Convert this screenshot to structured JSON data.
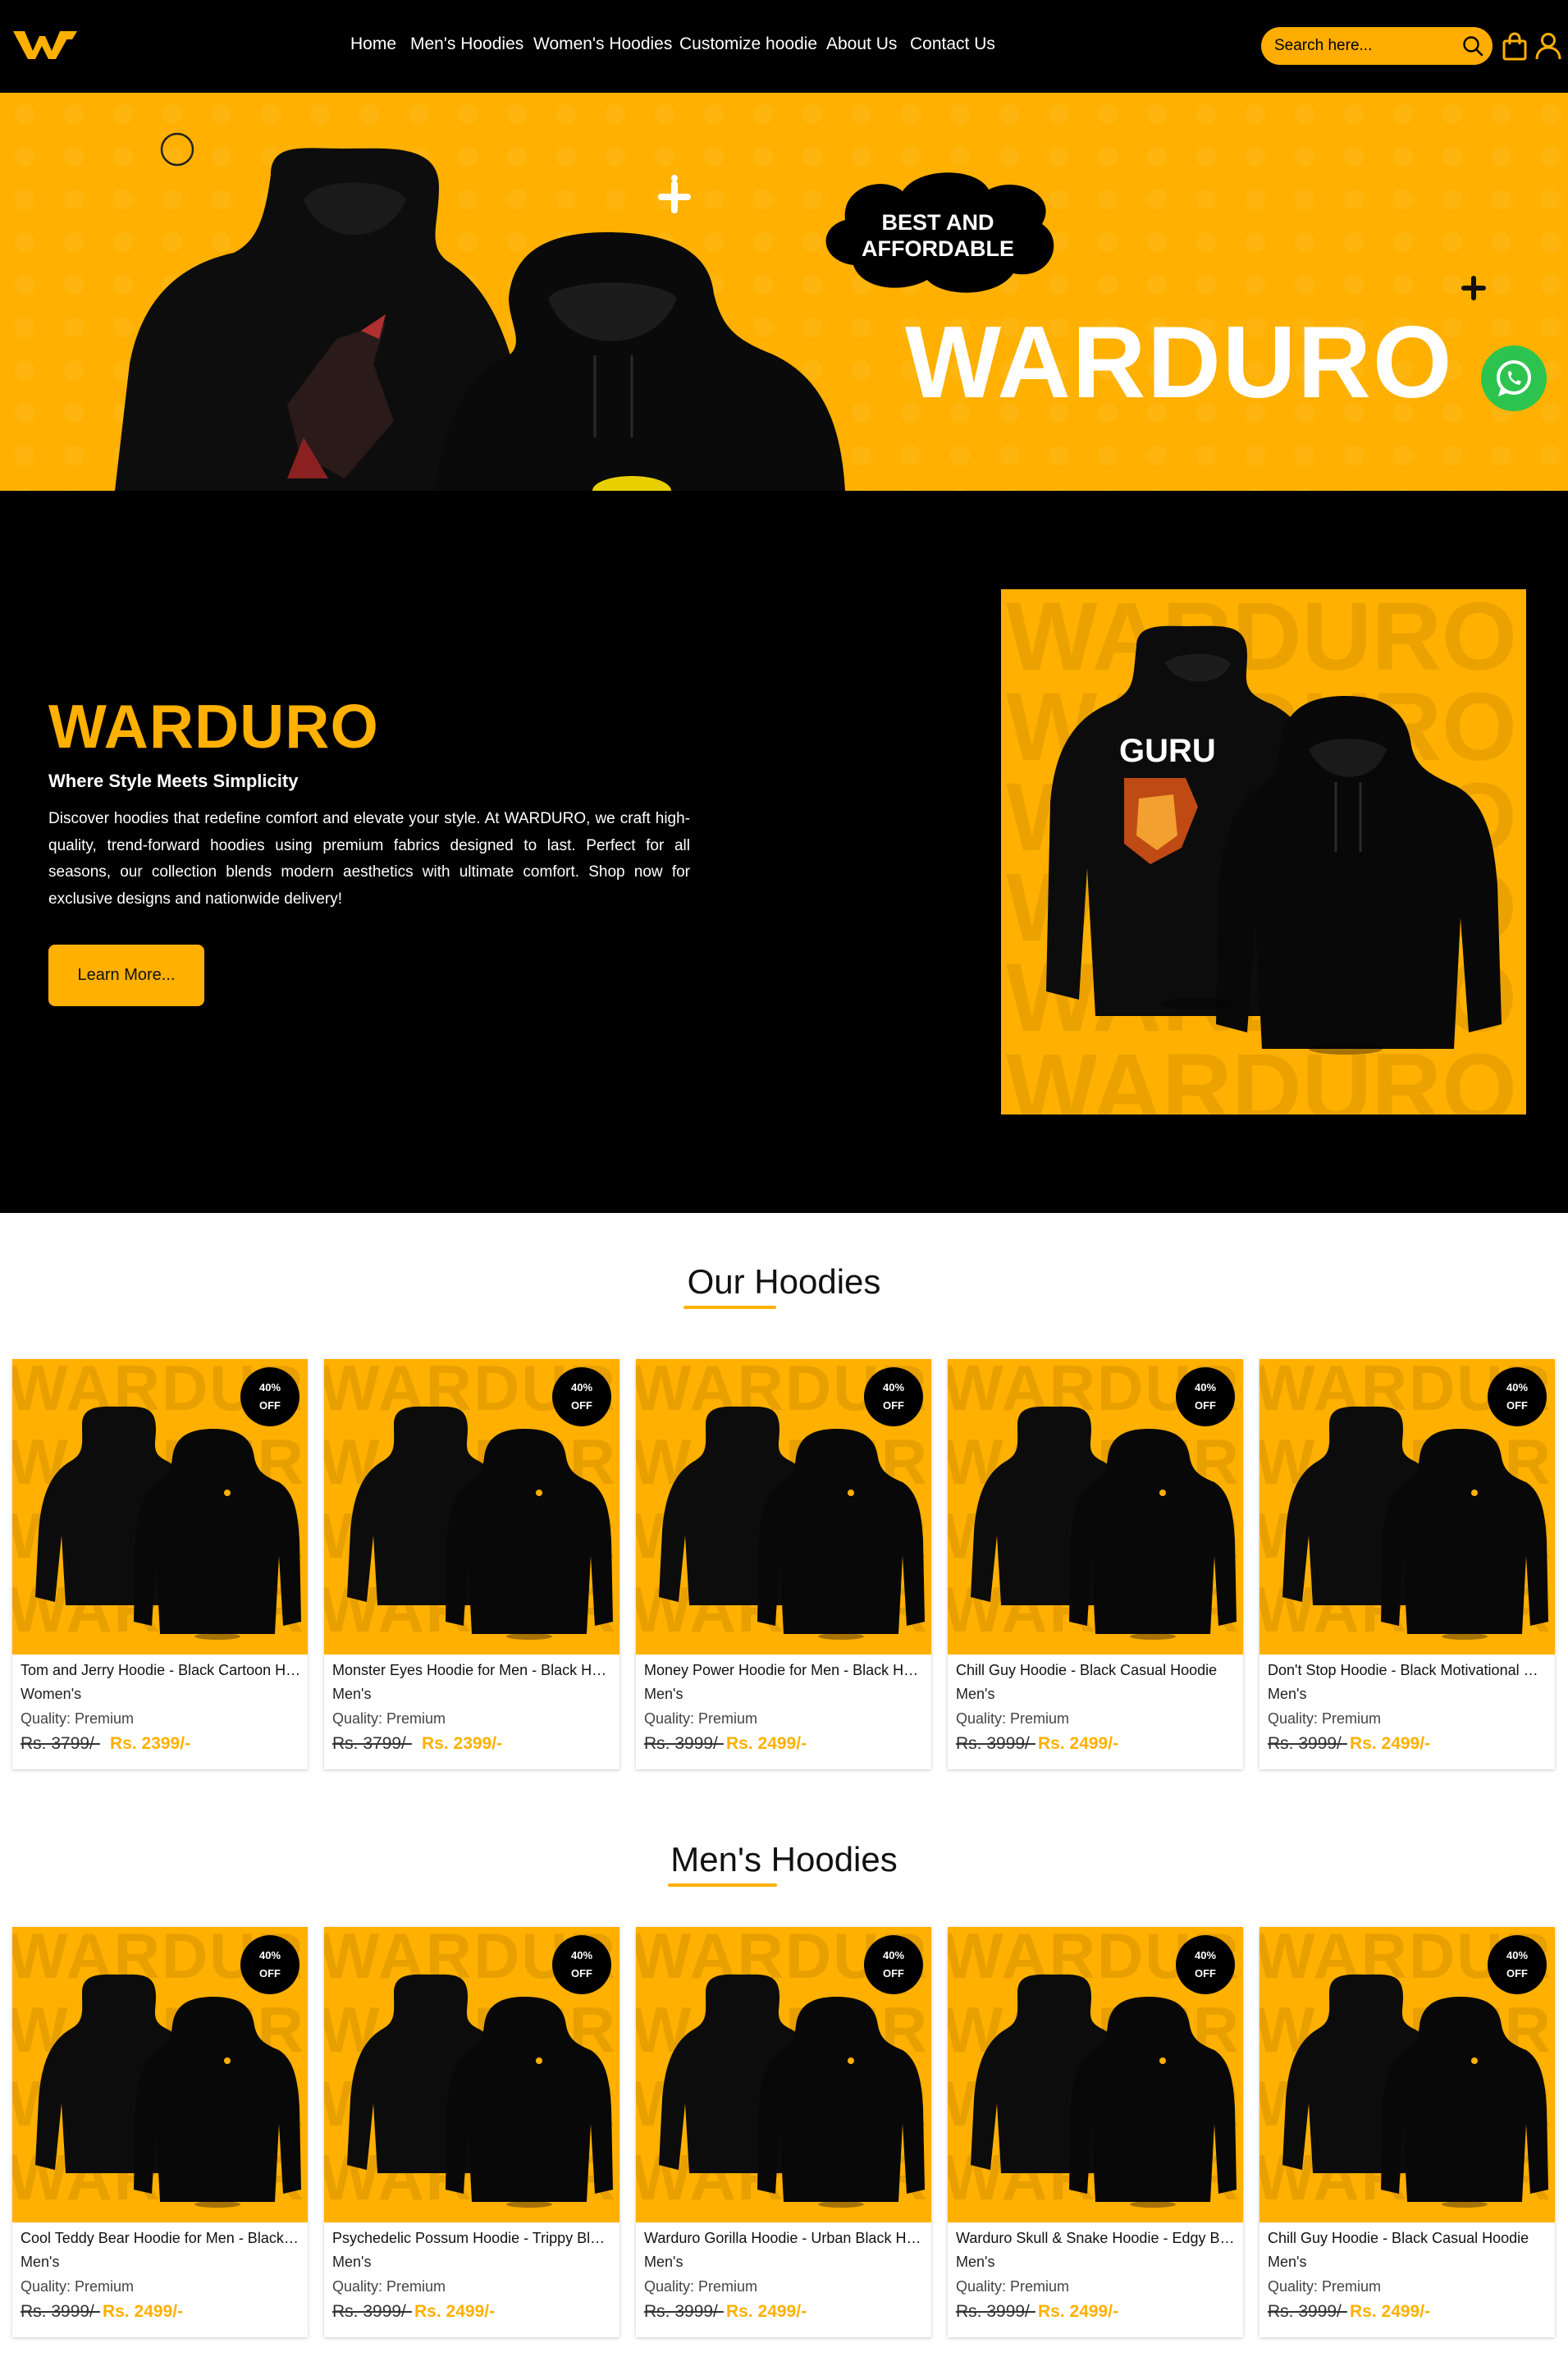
{
  "nav": {
    "brand_logo": "warduro-w-logo",
    "items": [
      "Home",
      "Men's Hoodies",
      "Women's Hoodies",
      "Customize hoodie",
      "About Us",
      "Contact Us"
    ],
    "search_placeholder": "Search here...",
    "icons": [
      "search-icon",
      "shopping-bag-icon",
      "user-icon"
    ]
  },
  "hero": {
    "title": "WARDURO",
    "cloud_line1": "BEST AND",
    "cloud_line2": "AFFORDABLE"
  },
  "about": {
    "title": "WARDURO",
    "subtitle": "Where Style Meets Simplicity",
    "text": "Discover hoodies that redefine comfort and elevate your style. At WARDURO, we craft high-quality, trend-forward hoodies using premium fabrics designed to last. Perfect for all seasons, our collection blends modern aesthetics with ultimate comfort. Shop now for exclusive designs and nationwide delivery!",
    "button": "Learn More...",
    "image_print": "GURU",
    "image_watermark": "WARDURO"
  },
  "sections": [
    {
      "title": "Our Hoodies",
      "products": [
        {
          "name": "Tom and Jerry Hoodie - Black Cartoon Hoodie",
          "category": "Women's",
          "quality": "Quality: Premium",
          "old_price": "Rs. 3799/-",
          "new_price": "Rs. 2399/-",
          "badge_line1": "40%",
          "badge_line2": "OFF"
        },
        {
          "name": "Monster Eyes Hoodie for Men - Black Hoodie",
          "category": "Men's",
          "quality": "Quality: Premium",
          "old_price": "Rs. 3799/-",
          "new_price": "Rs. 2399/-",
          "badge_line1": "40%",
          "badge_line2": "OFF"
        },
        {
          "name": "Money Power Hoodie for Men - Black Hoodie",
          "category": "Men's",
          "quality": "Quality: Premium",
          "old_price": "Rs. 3999/-",
          "new_price": "Rs. 2499/-",
          "badge_line1": "40%",
          "badge_line2": "OFF"
        },
        {
          "name": "Chill Guy Hoodie - Black Casual Hoodie",
          "category": "Men's",
          "quality": "Quality: Premium",
          "old_price": "Rs. 3999/-",
          "new_price": "Rs. 2499/-",
          "badge_line1": "40%",
          "badge_line2": "OFF"
        },
        {
          "name": "Don't Stop Hoodie - Black Motivational Hoodie",
          "category": "Men's",
          "quality": "Quality: Premium",
          "old_price": "Rs. 3999/-",
          "new_price": "Rs. 2499/-",
          "badge_line1": "40%",
          "badge_line2": "OFF"
        }
      ]
    },
    {
      "title": "Men's Hoodies",
      "products": [
        {
          "name": "Cool Teddy Bear Hoodie for Men - Black Hoodie",
          "category": "Men's",
          "quality": "Quality: Premium",
          "old_price": "Rs. 3999/-",
          "new_price": "Rs. 2499/-",
          "badge_line1": "40%",
          "badge_line2": "OFF"
        },
        {
          "name": "Psychedelic Possum Hoodie - Trippy Black Hoodie",
          "category": "Men's",
          "quality": "Quality: Premium",
          "old_price": "Rs. 3999/-",
          "new_price": "Rs. 2499/-",
          "badge_line1": "40%",
          "badge_line2": "OFF"
        },
        {
          "name": "Warduro Gorilla Hoodie - Urban Black Hoodie",
          "category": "Men's",
          "quality": "Quality: Premium",
          "old_price": "Rs. 3999/-",
          "new_price": "Rs. 2499/-",
          "badge_line1": "40%",
          "badge_line2": "OFF"
        },
        {
          "name": "Warduro Skull & Snake Hoodie - Edgy Black Hoodie",
          "category": "Men's",
          "quality": "Quality: Premium",
          "old_price": "Rs. 3999/-",
          "new_price": "Rs. 2499/-",
          "badge_line1": "40%",
          "badge_line2": "OFF"
        },
        {
          "name": "Chill Guy Hoodie - Black Casual Hoodie",
          "category": "Men's",
          "quality": "Quality: Premium",
          "old_price": "Rs. 3999/-",
          "new_price": "Rs. 2499/-",
          "badge_line1": "40%",
          "badge_line2": "OFF"
        }
      ]
    }
  ],
  "colors": {
    "accent": "#ffb000",
    "nav_bg": "#000000",
    "whatsapp": "#2cc44f"
  }
}
